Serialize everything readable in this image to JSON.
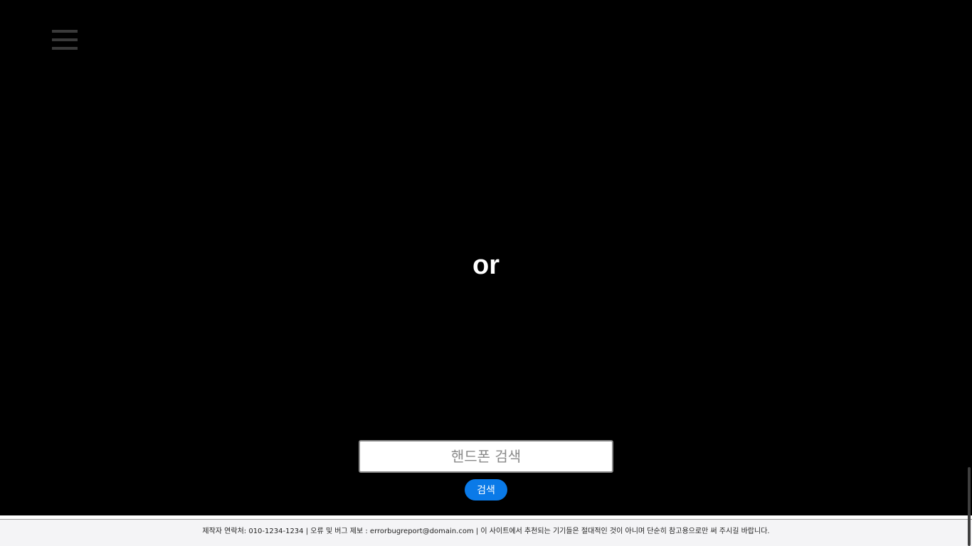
{
  "header": {
    "menu_icon": "hamburger-menu-icon"
  },
  "main": {
    "or_text": "or"
  },
  "search": {
    "placeholder": "핸드폰 검색",
    "value": "",
    "button_label": "검색",
    "button_color": "#0a7ae8"
  },
  "footer": {
    "text": "제작자 연락처: 010-1234-1234 | 오류 및 버그 제보 : errorbugreport@domain.com | 이 사이트에서 추천되는 기기들은 절대적인 것이 아니며 단순히 참고용으로만 써 주시길 바랍니다."
  }
}
